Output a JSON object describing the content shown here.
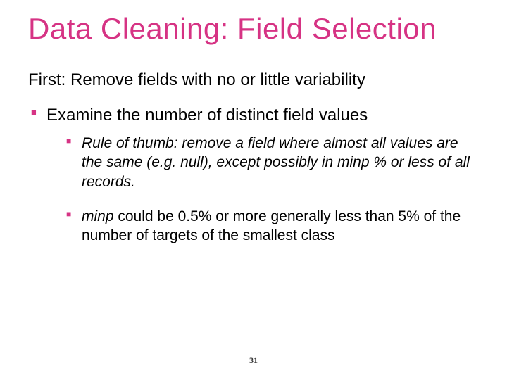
{
  "title": "Data Cleaning: Field Selection",
  "intro": "First: Remove fields with no or little variability",
  "bullets": {
    "l1_0": "Examine the number of distinct field values",
    "l2_0_pre": "Rule of thumb: remove a field where almost all values are the same (e.g. null), except  possibly in minp % or less of all records.",
    "l2_1_term": "minp",
    "l2_1_rest": " could be 0.5% or more generally less than 5% of the number of targets of the smallest class"
  },
  "page_number": "31"
}
